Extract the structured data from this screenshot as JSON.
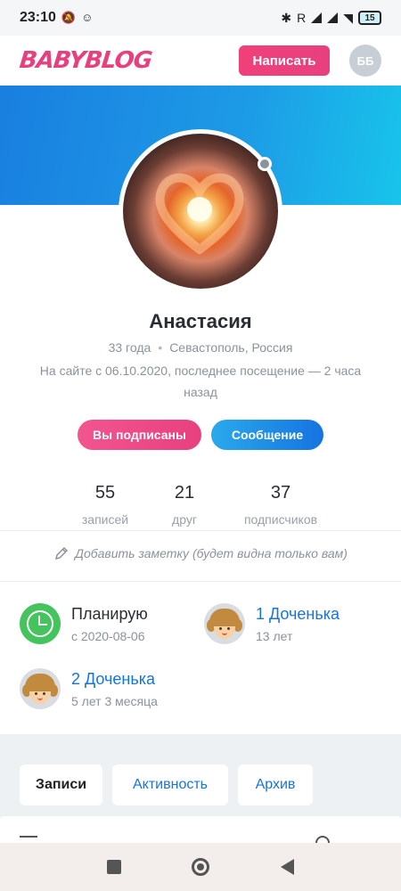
{
  "status_bar": {
    "time": "23:10",
    "carrier": "R",
    "battery": "15"
  },
  "header": {
    "logo": "BABYBLOG",
    "write_label": "Написать",
    "user_initials": "ББ"
  },
  "profile": {
    "name": "Анастасия",
    "age": "33 года",
    "location": "Севастополь, Россия",
    "since": "На сайте с 06.10.2020, последнее посещение — 2 часа назад",
    "subscribed_label": "Вы подписаны",
    "message_label": "Сообщение",
    "online_status": "offline"
  },
  "stats": [
    {
      "value": "55",
      "label": "записей"
    },
    {
      "value": "21",
      "label": "друг"
    },
    {
      "value": "37",
      "label": "подписчиков"
    }
  ],
  "note": {
    "label": "Добавить заметку (будет видна только вам)"
  },
  "info": [
    {
      "title": "Планирую",
      "subtitle": "с 2020-08-06",
      "icon": "clock-icon",
      "link": false
    },
    {
      "title": "1 Доченька",
      "subtitle": "13 лет",
      "icon": "girl-avatar-icon",
      "link": true
    },
    {
      "title": "2 Доченька",
      "subtitle": "5 лет 3 месяца",
      "icon": "girl-avatar-icon",
      "link": true
    }
  ],
  "tabs": [
    {
      "label": "Записи",
      "active": true
    },
    {
      "label": "Активность",
      "active": false
    },
    {
      "label": "Архив",
      "active": false
    }
  ],
  "colors": {
    "brand_pink": "#e8407e",
    "brand_blue": "#1673e0",
    "planning_green": "#45c35d"
  }
}
